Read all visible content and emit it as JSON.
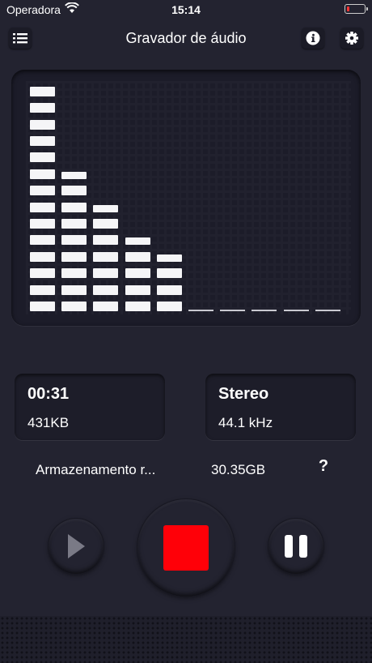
{
  "status_bar": {
    "carrier": "Operadora",
    "time": "15:14",
    "battery_color": "#ff3333"
  },
  "header": {
    "title": "Gravador de áudio",
    "menu_icon": "list-icon",
    "info_icon": "info-icon",
    "settings_icon": "gear-icon"
  },
  "level_meter": {
    "bar_segment_counts": [
      14,
      9,
      7,
      5,
      4,
      0,
      0,
      0,
      0,
      0
    ],
    "segment_color": "#f5f5f7"
  },
  "recording": {
    "elapsed": "00:31",
    "size": "431KB"
  },
  "format": {
    "channels": "Stereo",
    "sample_rate": "44.1 kHz"
  },
  "storage": {
    "label": "Armazenamento r...",
    "free": "30.35GB",
    "help": "?"
  },
  "controls": {
    "play_icon": "play-icon",
    "stop_icon": "stop-icon",
    "pause_icon": "pause-icon",
    "stop_color": "#ff0008"
  }
}
